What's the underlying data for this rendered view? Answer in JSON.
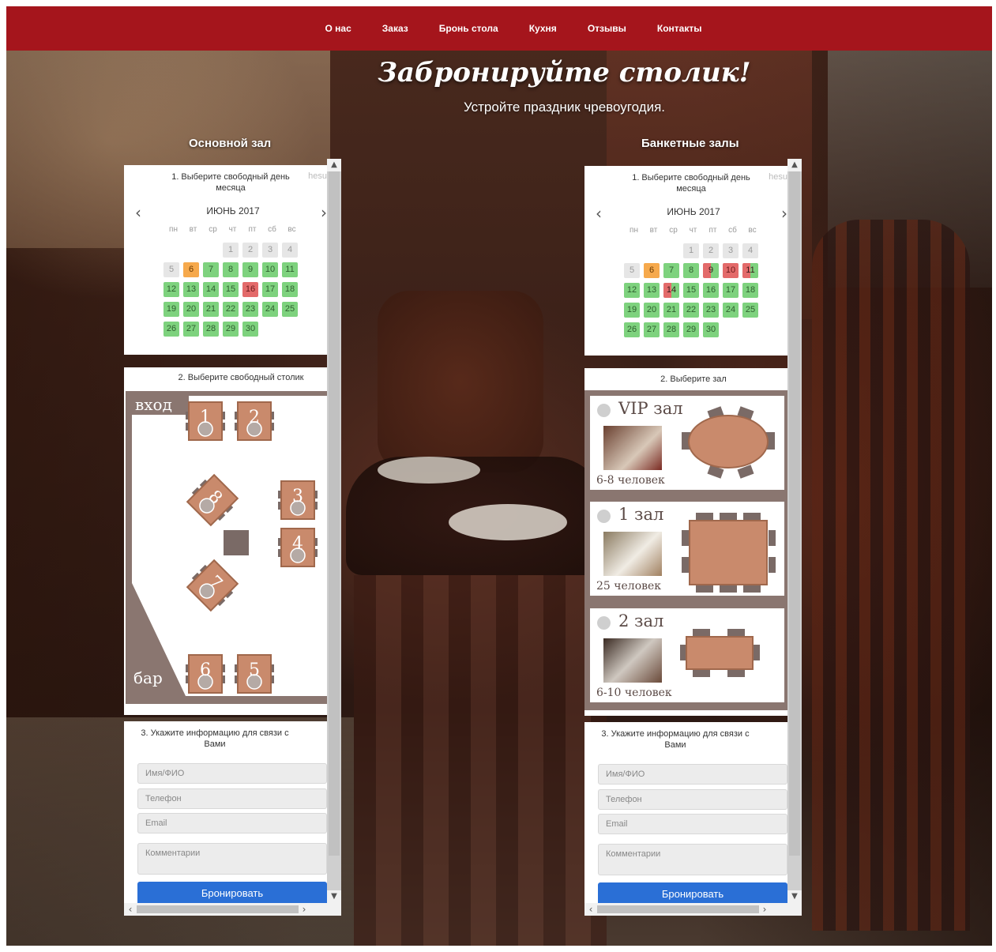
{
  "nav": {
    "items": [
      "О нас",
      "Заказ",
      "Бронь стола",
      "Кухня",
      "Отзывы",
      "Контакты"
    ]
  },
  "hero": {
    "title": "Забронируйте столик!",
    "subtitle": "Устройте праздник чревоугодия."
  },
  "left": {
    "heading": "Основной зал",
    "step1": "1. Выберите свободный день месяца",
    "ghost": "hesu",
    "month": "ИЮНЬ 2017",
    "prev_icon": "chevron-left-icon",
    "next_icon": "chevron-right-icon",
    "weekdays": [
      "пн",
      "вт",
      "ср",
      "чт",
      "пт",
      "сб",
      "вс"
    ],
    "days": [
      {
        "d": "1",
        "s": "past"
      },
      {
        "d": "2",
        "s": "past"
      },
      {
        "d": "3",
        "s": "past"
      },
      {
        "d": "4",
        "s": "past"
      },
      {
        "d": "5",
        "s": "past"
      },
      {
        "d": "6",
        "s": "today"
      },
      {
        "d": "7",
        "s": "free"
      },
      {
        "d": "8",
        "s": "free"
      },
      {
        "d": "9",
        "s": "free"
      },
      {
        "d": "10",
        "s": "free"
      },
      {
        "d": "11",
        "s": "free"
      },
      {
        "d": "12",
        "s": "free"
      },
      {
        "d": "13",
        "s": "free"
      },
      {
        "d": "14",
        "s": "free"
      },
      {
        "d": "15",
        "s": "free"
      },
      {
        "d": "16",
        "s": "busy"
      },
      {
        "d": "17",
        "s": "free"
      },
      {
        "d": "18",
        "s": "free"
      },
      {
        "d": "19",
        "s": "free"
      },
      {
        "d": "20",
        "s": "free"
      },
      {
        "d": "21",
        "s": "free"
      },
      {
        "d": "22",
        "s": "free"
      },
      {
        "d": "23",
        "s": "free"
      },
      {
        "d": "24",
        "s": "free"
      },
      {
        "d": "25",
        "s": "free"
      },
      {
        "d": "26",
        "s": "free"
      },
      {
        "d": "27",
        "s": "free"
      },
      {
        "d": "28",
        "s": "free"
      },
      {
        "d": "29",
        "s": "free"
      },
      {
        "d": "30",
        "s": "free"
      }
    ],
    "step2": "2. Выберите свободный столик",
    "plan": {
      "entrance": "вход",
      "bar": "бар",
      "tables": [
        "1",
        "2",
        "3",
        "4",
        "5",
        "6",
        "7",
        "8"
      ]
    },
    "step3": "3. Укажите информацию для связи с Вами",
    "name_ph": "Имя/ФИО",
    "phone_ph": "Телефон",
    "email_ph": "Email",
    "comment_ph": "Комментарии",
    "submit": "Бронировать"
  },
  "right": {
    "heading": "Банкетные залы",
    "step1": "1. Выберите свободный день месяца",
    "ghost": "hesu",
    "month": "ИЮНЬ 2017",
    "weekdays": [
      "пн",
      "вт",
      "ср",
      "чт",
      "пт",
      "сб",
      "вс"
    ],
    "days": [
      {
        "d": "1",
        "s": "past"
      },
      {
        "d": "2",
        "s": "past"
      },
      {
        "d": "3",
        "s": "past"
      },
      {
        "d": "4",
        "s": "past"
      },
      {
        "d": "5",
        "s": "past"
      },
      {
        "d": "6",
        "s": "today"
      },
      {
        "d": "7",
        "s": "free"
      },
      {
        "d": "8",
        "s": "free"
      },
      {
        "d": "9",
        "s": "half"
      },
      {
        "d": "10",
        "s": "busy"
      },
      {
        "d": "11",
        "s": "half"
      },
      {
        "d": "12",
        "s": "free"
      },
      {
        "d": "13",
        "s": "free"
      },
      {
        "d": "14",
        "s": "half"
      },
      {
        "d": "15",
        "s": "free"
      },
      {
        "d": "16",
        "s": "free"
      },
      {
        "d": "17",
        "s": "free"
      },
      {
        "d": "18",
        "s": "free"
      },
      {
        "d": "19",
        "s": "free"
      },
      {
        "d": "20",
        "s": "free"
      },
      {
        "d": "21",
        "s": "free"
      },
      {
        "d": "22",
        "s": "free"
      },
      {
        "d": "23",
        "s": "free"
      },
      {
        "d": "24",
        "s": "free"
      },
      {
        "d": "25",
        "s": "free"
      },
      {
        "d": "26",
        "s": "free"
      },
      {
        "d": "27",
        "s": "free"
      },
      {
        "d": "28",
        "s": "free"
      },
      {
        "d": "29",
        "s": "free"
      },
      {
        "d": "30",
        "s": "free"
      }
    ],
    "step2": "2. Выберите зал",
    "halls": [
      {
        "name": "VIP зал",
        "capacity": "6-8 человек"
      },
      {
        "name": "1 зал",
        "capacity": "25 человек"
      },
      {
        "name": "2 зал",
        "capacity": "6-10 человек"
      }
    ],
    "step3": "3. Укажите информацию для связи с Вами",
    "name_ph": "Имя/ФИО",
    "phone_ph": "Телефон",
    "email_ph": "Email",
    "comment_ph": "Комментарии",
    "submit": "Бронировать"
  },
  "colors": {
    "nav": "#a5151c",
    "free": "#7ed27e",
    "busy": "#e36a6a",
    "today": "#f6a94c",
    "past": "#e6e6e6",
    "button": "#2a6fd6",
    "table": "#c98a6c",
    "plan_border": "#8a7670"
  }
}
